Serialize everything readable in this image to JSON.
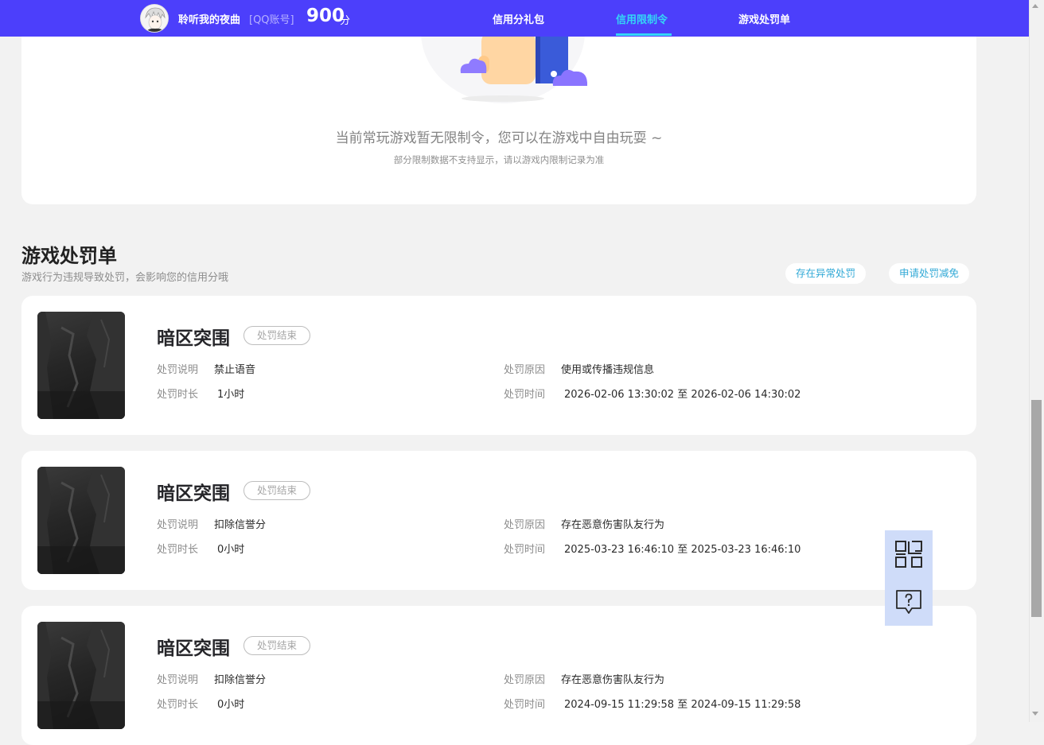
{
  "header": {
    "username": "聆听我的夜曲",
    "account_type": "[QQ账号]",
    "score": "900",
    "score_unit": "分",
    "tabs": [
      {
        "label": "信用分礼包",
        "active": false
      },
      {
        "label": "信用限制令",
        "active": true
      },
      {
        "label": "游戏处罚单",
        "active": false
      }
    ],
    "accent_color": "#4c3ffb",
    "active_tab_color": "#34d6f6"
  },
  "restriction": {
    "empty_title": "当前常玩游戏暂无限制令，您可以在游戏中自由玩耍 ~",
    "empty_sub": "部分限制数据不支持显示，请以游戏内限制记录为准"
  },
  "punishments": {
    "title": "游戏处罚单",
    "desc": "游戏行为违规导致处罚，会影响您的信用分哦",
    "buttons": {
      "abnormal": "存在异常处罚",
      "reduce": "申请处罚减免"
    },
    "labels": {
      "explain": "处罚说明",
      "duration": "处罚时长",
      "reason": "处罚原因",
      "time": "处罚时间",
      "to": "至"
    },
    "items": [
      {
        "game": "暗区突围",
        "status": "处罚结束",
        "explain": "禁止语音",
        "duration": "1小时",
        "reason": "使用或传播违规信息",
        "start": "2026-02-06 13:30:02",
        "end": "2026-02-06 14:30:02"
      },
      {
        "game": "暗区突围",
        "status": "处罚结束",
        "explain": "扣除信誉分",
        "duration": "0小时",
        "reason": "存在恶意伤害队友行为",
        "start": "2025-03-23 16:46:10",
        "end": "2025-03-23 16:46:10"
      },
      {
        "game": "暗区突围",
        "status": "处罚结束",
        "explain": "扣除信誉分",
        "duration": "0小时",
        "reason": "存在恶意伤害队友行为",
        "start": "2024-09-15 11:29:58",
        "end": "2024-09-15 11:29:58"
      }
    ]
  },
  "float_tools": [
    {
      "icon": "qr-code-icon"
    },
    {
      "icon": "help-chat-icon"
    }
  ]
}
